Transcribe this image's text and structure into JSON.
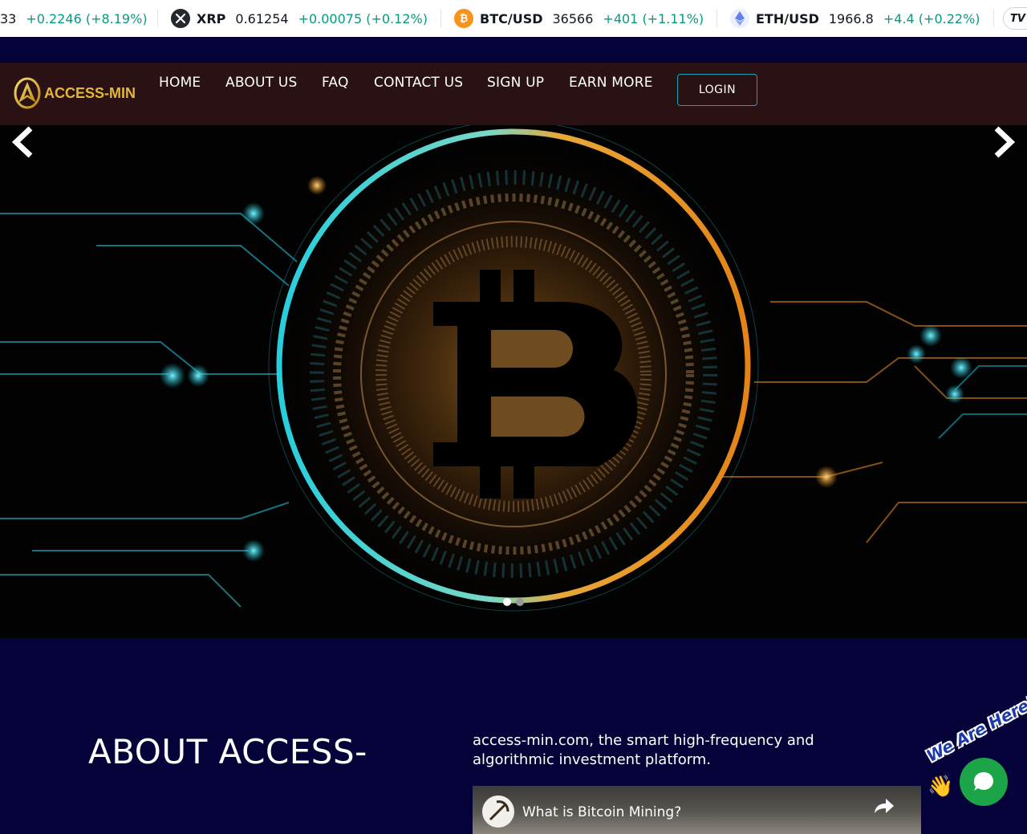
{
  "ticker": {
    "items": [
      {
        "symbol": "",
        "price": "33",
        "change": "+0.2246 (+8.19%)",
        "icon": ""
      },
      {
        "symbol": "XRP",
        "price": "0.61254",
        "change": "+0.00075 (+0.12%)",
        "icon": "xrp-icon"
      },
      {
        "symbol": "BTC/USD",
        "price": "36566",
        "change": "+401 (+1.11%)",
        "icon": "bitcoin-icon"
      },
      {
        "symbol": "ETH/USD",
        "price": "1966.8",
        "change": "+4.4 (+0.22%)",
        "icon": "ethereum-icon"
      }
    ],
    "tv_logo": "TV"
  },
  "nav": {
    "logo_text": "ACCESS-MIN",
    "links": [
      "HOME",
      "ABOUT US",
      "FAQ",
      "CONTACT US",
      "SIGN UP",
      "EARN MORE"
    ],
    "login_label": "LOGIN"
  },
  "hero": {
    "slide_count": 2,
    "active_slide": 1
  },
  "about": {
    "title": "ABOUT ACCESS-",
    "intro": "access-min.com, the smart high-frequency and algorithmic investment platform.",
    "video_title": "What is Bitcoin Mining?"
  },
  "chat": {
    "badge": "We Are Here!"
  },
  "colors": {
    "page_bg": "#05023a",
    "nav_bg": "#2a1214",
    "positive_change": "#089981",
    "login_border": "#17a2b8",
    "chat_green": "#1ba548",
    "logo_gold": "#e4b63a"
  }
}
